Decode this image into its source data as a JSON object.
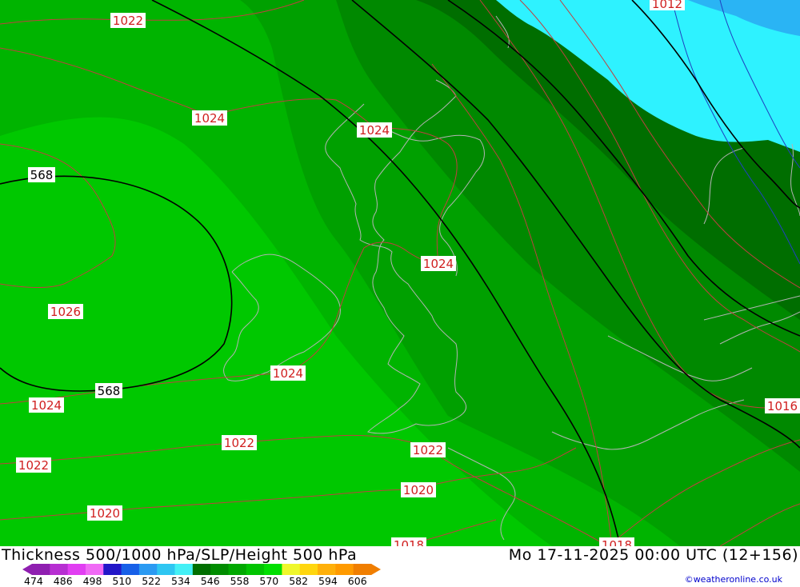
{
  "footer": {
    "title": "Thickness 500/1000 hPa/SLP/Height 500 hPa",
    "datetime": "Mo 17-11-2025 00:00 UTC (12+156)",
    "credit": "©weatheronline.co.uk"
  },
  "legend": {
    "values": [
      "474",
      "486",
      "498",
      "510",
      "522",
      "534",
      "546",
      "558",
      "570",
      "582",
      "594",
      "606"
    ],
    "colors": [
      "#8f1fb0",
      "#b72fd2",
      "#e13ef2",
      "#f06af5",
      "#2216c8",
      "#1760e8",
      "#2a9af2",
      "#2ec6f2",
      "#44f0f6",
      "#006f00",
      "#008c00",
      "#00a800",
      "#00c400",
      "#00df00",
      "#eff72c",
      "#ffd60f",
      "#ffb00a",
      "#ff9a00",
      "#f07e00"
    ]
  },
  "isobar_labels": [
    {
      "text": "1022"
    },
    {
      "text": "1024"
    },
    {
      "text": "1024"
    },
    {
      "text": "1024"
    },
    {
      "text": "1026"
    },
    {
      "text": "1024"
    },
    {
      "text": "1024"
    },
    {
      "text": "1022"
    },
    {
      "text": "1022"
    },
    {
      "text": "1022"
    },
    {
      "text": "1020"
    },
    {
      "text": "1020"
    },
    {
      "text": "1018"
    },
    {
      "text": "1018"
    },
    {
      "text": "1016"
    },
    {
      "text": "1012"
    }
  ],
  "height_labels": [
    {
      "text": "568"
    },
    {
      "text": "568"
    }
  ]
}
